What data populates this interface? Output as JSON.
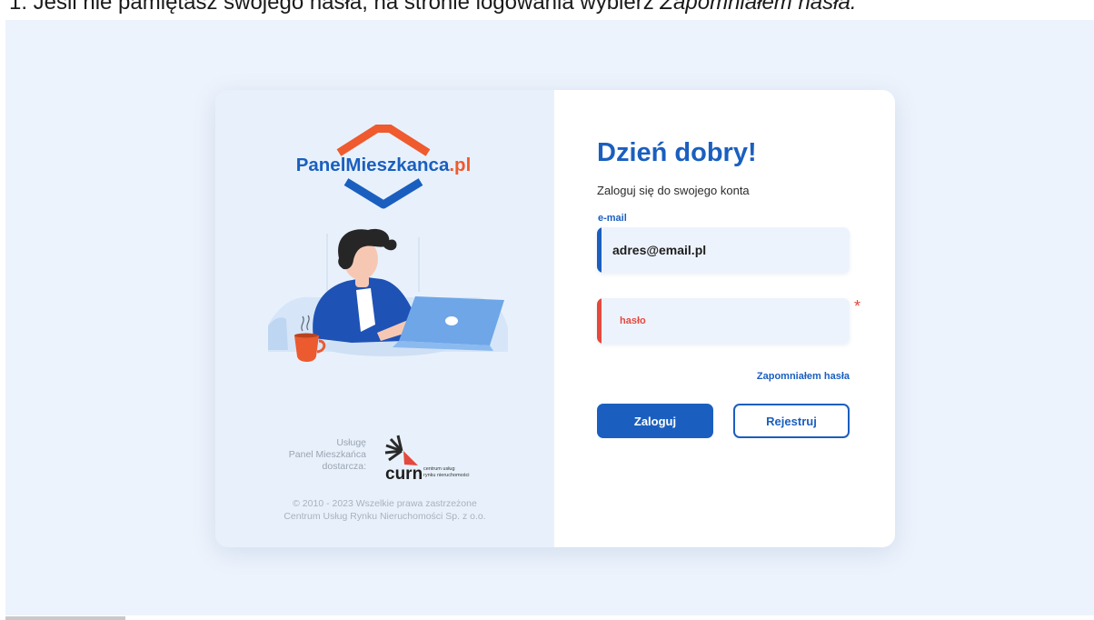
{
  "caption": {
    "text_start": "1.   Jeśli nie pamiętasz swojego hasła, na stronie logowania wybierz ",
    "text_emphasis": "Zapomniałem hasła."
  },
  "brand": {
    "logo_text_main": "PanelMieszkanca",
    "logo_text_suffix": ".pl",
    "logo_colors": {
      "orange": "#ef5a2f",
      "blue": "#1a5fbf"
    },
    "provider_text": [
      "Usługę",
      "Panel Mieszkańca",
      "dostarcza:"
    ],
    "provider_logo_word": "curn",
    "provider_logo_caption": [
      "centrum usług",
      "rynku nieruchomości"
    ],
    "copyright": [
      "© 2010 - 2023 Wszelkie prawa zastrzeżone",
      "Centrum Usług Rynku Nieruchomości Sp. z o.o."
    ]
  },
  "illustration": {
    "icon": "person-working-on-laptop-illustration"
  },
  "login": {
    "greeting": "Dzień dobry!",
    "subtitle": "Zaloguj się do swojego konta",
    "email_label": "e-mail",
    "email_value": "adres@email.pl",
    "password_placeholder": "hasło",
    "required_mark": "*",
    "forgot_link": "Zapomniałem hasła",
    "login_button": "Zaloguj",
    "register_button": "Rejestruj"
  },
  "colors": {
    "accent": "#1a5fbf",
    "error": "#e5483d",
    "panel_background": "#e8f1fb",
    "page_background": "#edf3fc"
  }
}
